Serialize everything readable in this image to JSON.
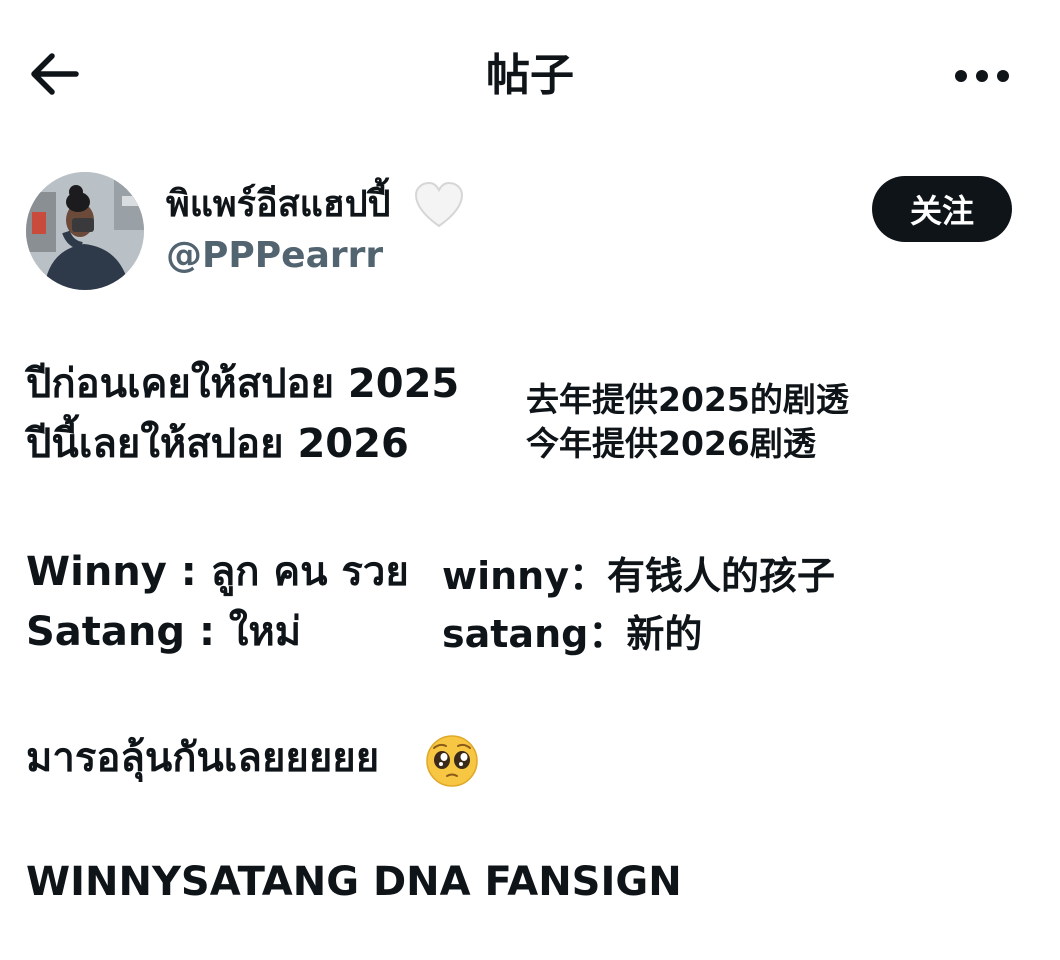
{
  "header": {
    "title": "帖子"
  },
  "author": {
    "display_name": "พิแพร์อีสแฮปปี้",
    "username": "@PPPearrr",
    "follow_label": "关注"
  },
  "post": {
    "thai_line1": "ปีก่อนเคยให้สปอย 2025",
    "thai_line2": "ปีนี้เลยให้สปอย 2026",
    "cn_line1": "去年提供2025的剧透",
    "cn_line2": "今年提供2026剧透",
    "winny_thai": "Winny : ลูก คน รวย",
    "satang_thai": "Satang : ใหม่",
    "winny_cn": "winny：有钱人的孩子",
    "satang_cn": "satang：新的",
    "closing_line": "มารอลุ้นกันเลยยยยย",
    "tag_line": "WINNYSATANG DNA FANSIGN"
  },
  "icons": {
    "back": "back-arrow-icon",
    "more": "more-dots-icon",
    "heart": "white-heart-emoji",
    "emoji": "pleading-face-emoji"
  },
  "colors": {
    "text": "#0f1419",
    "secondary": "#536471",
    "button_bg": "#0f1419",
    "button_text": "#ffffff"
  }
}
